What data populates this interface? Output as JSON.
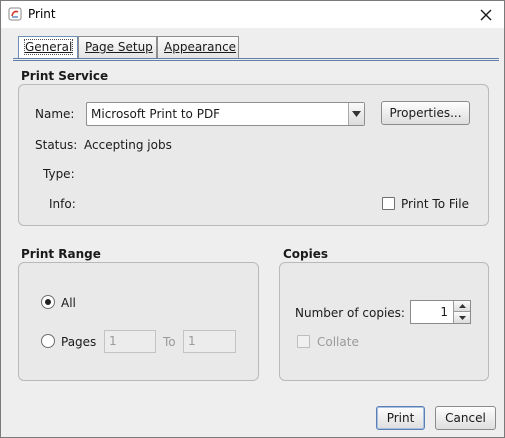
{
  "window": {
    "title": "Print",
    "icon": "print-app-icon",
    "close_icon": "close-icon"
  },
  "tabs": [
    {
      "label": "General",
      "active": true
    },
    {
      "label": "Page Setup",
      "active": false
    },
    {
      "label": "Appearance",
      "active": false
    }
  ],
  "print_service": {
    "title": "Print Service",
    "name_label": "Name:",
    "printer": "Microsoft Print to PDF",
    "properties_label": "Properties...",
    "status_label": "Status:",
    "status_value": "Accepting jobs",
    "type_label": "Type:",
    "info_label": "Info:",
    "print_to_file_label": "Print To File",
    "print_to_file_checked": false
  },
  "print_range": {
    "title": "Print Range",
    "all_label": "All",
    "all_selected": true,
    "pages_label": "Pages",
    "from_value": "1",
    "to_label": "To",
    "to_value": "1"
  },
  "copies": {
    "title": "Copies",
    "number_label": "Number of copies:",
    "number_value": "1",
    "collate_label": "Collate",
    "collate_checked": false
  },
  "buttons": {
    "print": "Print",
    "cancel": "Cancel"
  }
}
